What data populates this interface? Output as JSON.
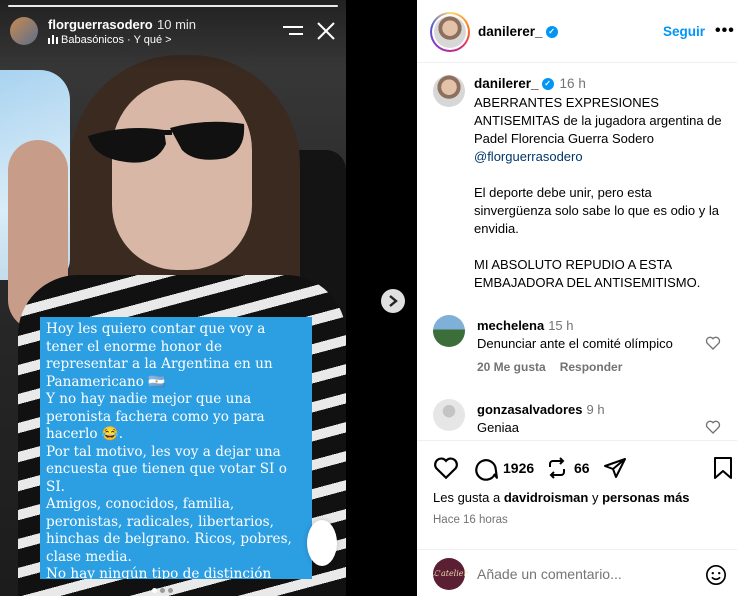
{
  "story": {
    "username": "florguerrasodero",
    "time": "10 min",
    "music": "Babasónicos · Y qué >",
    "caption": "Hoy les quiero contar que voy a tener el enorme honor de representar a la Argentina en un Panamericano 🇦🇷\nY no hay nadie mejor que una peronista fachera como yo para hacerlo 😂.\nPor tal motivo, les voy a dejar una encuesta que tienen que votar SI o SI.\nAmigos, conocidos, familia, peronistas, radicales, libertarios, hinchas de belgrano. Ricos, pobres, clase media.\nNo hay ningún tipo de distinción (excepto judíos: -ustedes no son bienvenidos-)"
  },
  "header": {
    "username": "danilerer_",
    "follow_label": "Seguir",
    "more_label": "•••"
  },
  "post": {
    "username": "danilerer_",
    "time": "16 h",
    "text": "ABERRANTES EXPRESIONES ANTISEMITAS de la jugadora argentina de Padel Florencia Guerra Sodero",
    "mention": "@florguerrasodero",
    "text2": "\n\nEl deporte debe unir, pero esta sinvergüenza solo sabe lo que es odio y la envidia.\n\nMI ABSOLUTO REPUDIO A ESTA EMBAJADORA DEL ANTISEMITISMO."
  },
  "comments": [
    {
      "username": "mechelena",
      "time": "15 h",
      "text": "Denunciar ante el comité olímpico",
      "likes": "20 Me gusta",
      "reply": "Responder"
    },
    {
      "username": "gonzasalvadores",
      "time": "9 h",
      "text": "Geniaa"
    }
  ],
  "actions": {
    "comments_count": "1926",
    "shares_count": "66",
    "likes_prefix": "Les gusta a ",
    "likes_user": "davidroisman",
    "likes_mid": " y ",
    "likes_rest": "personas más",
    "ago": "Hace 16 horas",
    "add_comment_placeholder": "Añade un comentario..."
  },
  "colors": {
    "accent": "#0095f6",
    "caption_bg": "#2c9ee2",
    "mention": "#00376b"
  }
}
